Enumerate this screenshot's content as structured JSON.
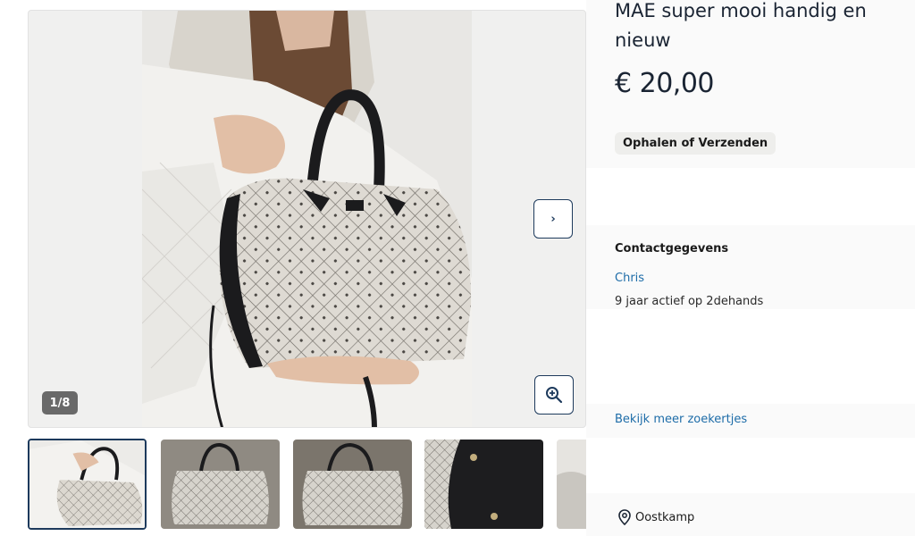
{
  "listing": {
    "title": "MAE super mooi handig en nieuw",
    "price": "€ 20,00",
    "delivery_badge": "Ophalen of Verzenden"
  },
  "gallery": {
    "counter": "1/8",
    "next_icon": "chevron-right-icon",
    "zoom_icon": "zoom-in-icon",
    "thumbnail_count_visible": 5,
    "active_thumbnail": 1
  },
  "contact": {
    "heading": "Contactgegevens",
    "seller_name": "Chris",
    "seller_meta": "9 jaar actief op 2dehands",
    "more_ads_link": "Bekijk meer zoekertjes"
  },
  "location": {
    "icon": "map-pin-icon",
    "city": "Oostkamp"
  },
  "colors": {
    "accent": "#1d3a5c",
    "link": "#1d6ca8"
  }
}
